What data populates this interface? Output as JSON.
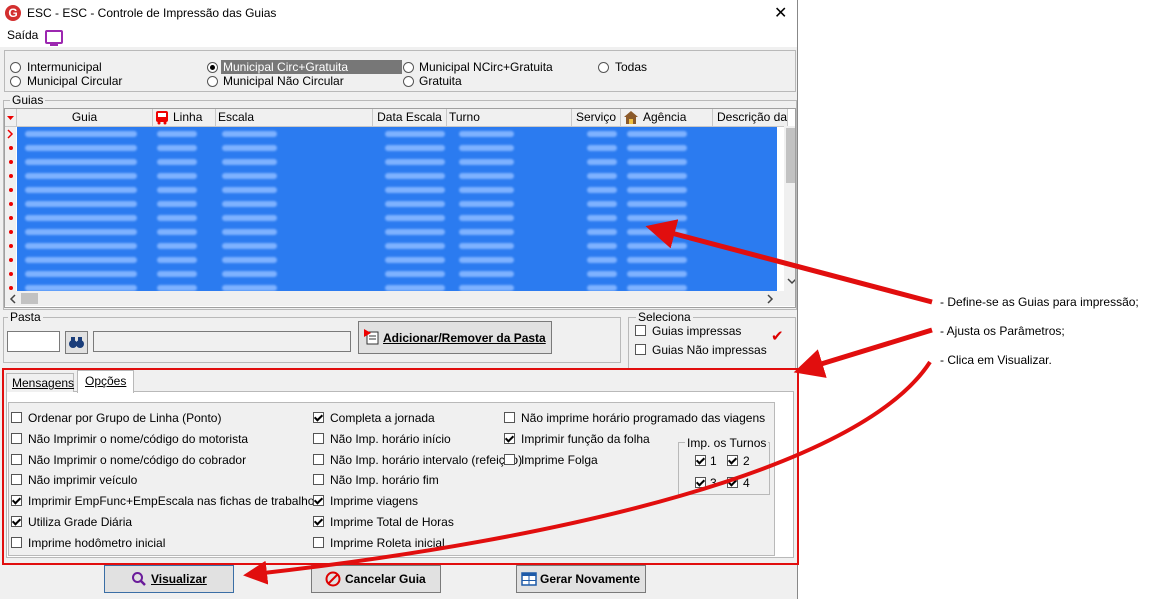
{
  "window": {
    "title": "ESC -  ESC - Controle de Impressão das Guias",
    "close_glyph": "✕",
    "logo_letter": "G"
  },
  "menu": {
    "saida": "Saída"
  },
  "radios": {
    "intermunicipal": "Intermunicipal",
    "municipal_circ_gratuita": "Municipal Circ+Gratuita",
    "municipal_ncirc_gratuita": "Municipal NCirc+Gratuita",
    "todas": "Todas",
    "municipal_circular": "Municipal Circular",
    "municipal_nao_circular": "Municipal Não Circular",
    "gratuita": "Gratuita",
    "selected": "municipal_circ_gratuita"
  },
  "guias": {
    "legend": "Guias",
    "columns": [
      "Guia",
      "Linha",
      "Escala",
      "Data Escala",
      "Turno",
      "Serviço",
      "Agência",
      "Descrição da"
    ],
    "visible_rows": 12
  },
  "pasta": {
    "legend": "Pasta",
    "add_remove_button": "Adicionar/Remover da Pasta"
  },
  "seleciona": {
    "legend": "Seleciona",
    "guias_impressas": "Guias impressas",
    "guias_nao_impressas": "Guias Não impressas",
    "check_glyph": "✔"
  },
  "tabs": {
    "mensagens": "Mensagens",
    "opcoes": "Opções"
  },
  "options": {
    "col1": [
      {
        "label": "Ordenar por Grupo de Linha (Ponto)",
        "checked": false
      },
      {
        "label": "Não Imprimir o nome/código do motorista",
        "checked": false
      },
      {
        "label": "Não Imprimir o nome/código do cobrador",
        "checked": false
      },
      {
        "label": "Não imprimir veículo",
        "checked": false
      },
      {
        "label": "Imprimir EmpFunc+EmpEscala nas fichas de trabalho",
        "checked": true
      },
      {
        "label": "Utiliza Grade Diária",
        "checked": true
      },
      {
        "label": "Imprime hodômetro inicial",
        "checked": false
      }
    ],
    "col2": [
      {
        "label": "Completa a jornada",
        "checked": true
      },
      {
        "label": "Não Imp. horário início",
        "checked": false
      },
      {
        "label": "Não Imp. horário intervalo (refeição)",
        "checked": false
      },
      {
        "label": "Não Imp. horário fim",
        "checked": false
      },
      {
        "label": "Imprime viagens",
        "checked": true
      },
      {
        "label": "Imprime Total de Horas",
        "checked": true
      },
      {
        "label": "Imprime Roleta inicial",
        "checked": false
      }
    ],
    "col3": [
      {
        "label": "Não imprime horário programado das viagens",
        "checked": false
      },
      {
        "label": "Imprimir função da folha",
        "checked": true
      },
      {
        "label": "Imprime Folga",
        "checked": false
      }
    ]
  },
  "turnos": {
    "legend": "Imp. os Turnos",
    "items": [
      {
        "label": "1",
        "checked": true
      },
      {
        "label": "2",
        "checked": true
      },
      {
        "label": "3",
        "checked": true
      },
      {
        "label": "4",
        "checked": true
      }
    ]
  },
  "buttons": {
    "visualizar": "Visualizar",
    "cancelar": "Cancelar Guia",
    "gerar": "Gerar Novamente"
  },
  "annotations": {
    "a1": "- Define-se as Guias para impressão;",
    "a2": "- Ajusta os Parâmetros;",
    "a3": "- Clica em Visualizar."
  },
  "colors": {
    "row_selected": "#2b7bf0",
    "annotation_red": "#e10e0e"
  }
}
